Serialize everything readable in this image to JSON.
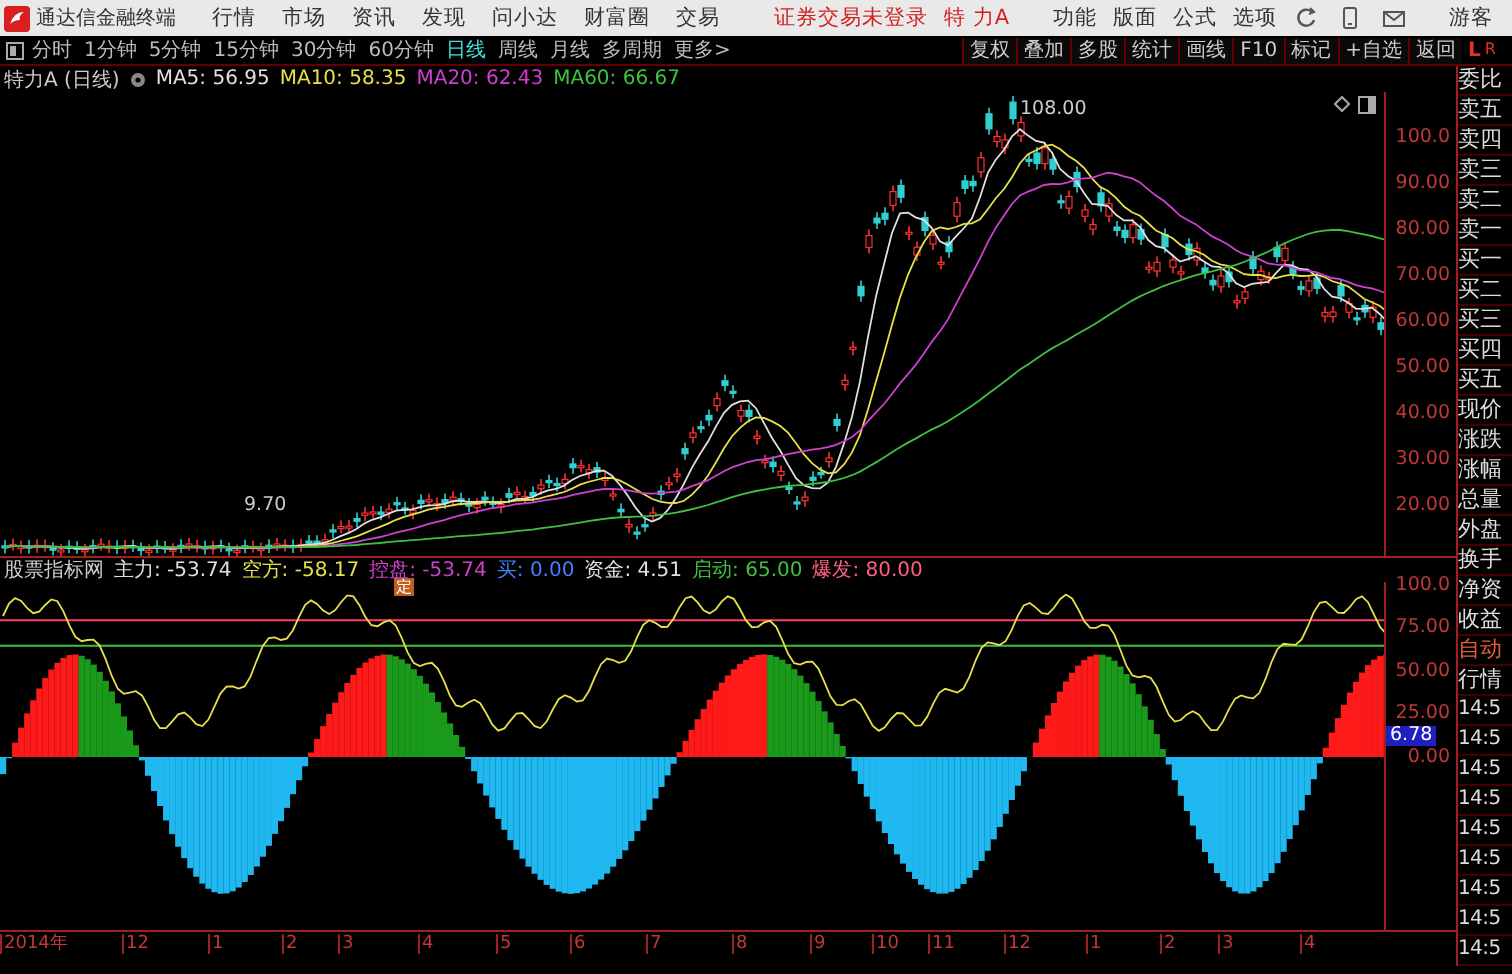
{
  "title_bar": {
    "app_name": "通达信金融终端",
    "menu": [
      "行情",
      "市场",
      "资讯",
      "发现",
      "问小达",
      "财富圈",
      "交易"
    ],
    "login_notice": "证券交易未登录",
    "stock_name": "特 力A",
    "right_menu": [
      "功能",
      "版面",
      "公式",
      "选项"
    ],
    "user": "游客"
  },
  "toolbar": {
    "periods": [
      {
        "label": "分时",
        "selected": false
      },
      {
        "label": "1分钟",
        "selected": false
      },
      {
        "label": "5分钟",
        "selected": false
      },
      {
        "label": "15分钟",
        "selected": false
      },
      {
        "label": "30分钟",
        "selected": false
      },
      {
        "label": "60分钟",
        "selected": false
      },
      {
        "label": "日线",
        "selected": true
      },
      {
        "label": "周线",
        "selected": false
      },
      {
        "label": "月线",
        "selected": false
      },
      {
        "label": "多周期",
        "selected": false
      },
      {
        "label": "更多>",
        "selected": false
      }
    ],
    "buttons": [
      "复权",
      "叠加",
      "多股",
      "统计",
      "画线",
      "F10",
      "标记",
      "+自选",
      "返回"
    ],
    "corner": [
      "L",
      "R"
    ]
  },
  "price_chart": {
    "title": "特力A (日线)",
    "ma": [
      {
        "label": "MA5: 56.95",
        "color": "#e0e0e0"
      },
      {
        "label": "MA10: 58.35",
        "color": "#e8e04a"
      },
      {
        "label": "MA20: 62.43",
        "color": "#d040d0"
      },
      {
        "label": "MA60: 66.67",
        "color": "#40c040"
      }
    ],
    "high_label": "108.00",
    "low_label": "9.70",
    "yticks": [
      "100.0",
      "90.00",
      "80.00",
      "70.00",
      "60.00",
      "50.00",
      "40.00",
      "30.00",
      "20.00"
    ]
  },
  "indicator": {
    "name": "股票指标网",
    "values": [
      {
        "label": "主力: -53.74",
        "color": "#e0e0e0"
      },
      {
        "label": "空方: -58.17",
        "color": "#e8e04a"
      },
      {
        "label": "控盘: -53.74",
        "color": "#d040d0"
      },
      {
        "label": "买: 0.00",
        "color": "#4080ff"
      },
      {
        "label": "资金: 4.51",
        "color": "#e0e0e0"
      },
      {
        "label": "启动: 65.00",
        "color": "#40c040"
      },
      {
        "label": "爆发: 80.00",
        "color": "#ff6080"
      }
    ],
    "marker": "定",
    "yticks": [
      "100.0",
      "75.00",
      "50.00",
      "25.00",
      "0.00"
    ],
    "current_value": "6.78"
  },
  "x_axis": [
    "2014年",
    "12",
    "1",
    "2",
    "3",
    "4",
    "5",
    "6",
    "7",
    "8",
    "9",
    "10",
    "11",
    "12",
    "1",
    "2",
    "3",
    "4"
  ],
  "quote_panel": [
    {
      "text": "委比",
      "kind": "label"
    },
    {
      "text": "卖五",
      "kind": "label"
    },
    {
      "text": "卖四",
      "kind": "label"
    },
    {
      "text": "卖三",
      "kind": "label"
    },
    {
      "text": "卖二",
      "kind": "label"
    },
    {
      "text": "卖一",
      "kind": "label"
    },
    {
      "text": "买一",
      "kind": "label"
    },
    {
      "text": "买二",
      "kind": "label"
    },
    {
      "text": "买三",
      "kind": "label"
    },
    {
      "text": "买四",
      "kind": "label"
    },
    {
      "text": "买五",
      "kind": "label"
    },
    {
      "text": "现价",
      "kind": "label"
    },
    {
      "text": "涨跌",
      "kind": "label"
    },
    {
      "text": "涨幅",
      "kind": "label"
    },
    {
      "text": "总量",
      "kind": "label"
    },
    {
      "text": "外盘",
      "kind": "label"
    },
    {
      "text": "换手",
      "kind": "label"
    },
    {
      "text": "净资",
      "kind": "label"
    },
    {
      "text": "收益",
      "kind": "label"
    },
    {
      "text": "自动",
      "kind": "mode"
    },
    {
      "text": "行情",
      "kind": "label"
    },
    {
      "text": "14:5",
      "kind": "time"
    },
    {
      "text": "14:5",
      "kind": "time"
    },
    {
      "text": "14:5",
      "kind": "time"
    },
    {
      "text": "14:5",
      "kind": "time"
    },
    {
      "text": "14:5",
      "kind": "time"
    },
    {
      "text": "14:5",
      "kind": "time"
    },
    {
      "text": "14:5",
      "kind": "time"
    },
    {
      "text": "14:5",
      "kind": "time"
    },
    {
      "text": "14:5",
      "kind": "time"
    }
  ]
}
